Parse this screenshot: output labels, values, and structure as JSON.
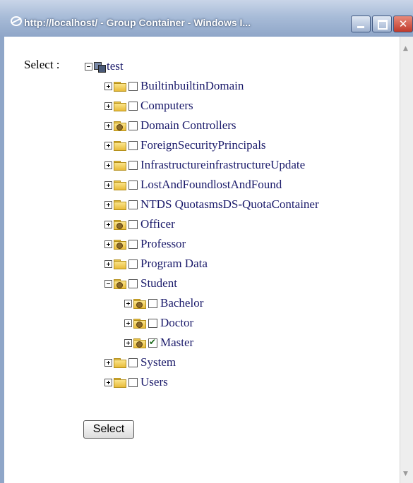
{
  "window": {
    "title": "http://localhost/ - Group Container - Windows I...",
    "close_glyph": "✕"
  },
  "form": {
    "select_label": "Select :",
    "select_button": "Select"
  },
  "tree": {
    "root": "test",
    "nodes": [
      {
        "label": "BuiltinbuiltinDomain",
        "icon": "folder-icon",
        "checked": false
      },
      {
        "label": "Computers",
        "icon": "folder-icon",
        "checked": false
      },
      {
        "label": "Domain Controllers",
        "icon": "org-unit-icon",
        "checked": false
      },
      {
        "label": "ForeignSecurityPrincipals",
        "icon": "folder-icon",
        "checked": false
      },
      {
        "label": "InfrastructureinfrastructureUpdate",
        "icon": "folder-icon",
        "checked": false
      },
      {
        "label": "LostAndFoundlostAndFound",
        "icon": "folder-icon",
        "checked": false
      },
      {
        "label": "NTDS QuotasmsDS-QuotaContainer",
        "icon": "folder-icon",
        "checked": false
      },
      {
        "label": "Officer",
        "icon": "org-unit-icon",
        "checked": false
      },
      {
        "label": "Professor",
        "icon": "org-unit-icon",
        "checked": false
      },
      {
        "label": "Program Data",
        "icon": "folder-icon",
        "checked": false
      },
      {
        "label": "Student",
        "icon": "org-unit-icon",
        "checked": false,
        "expanded": true
      },
      {
        "label": "Bachelor",
        "icon": "org-unit-icon",
        "checked": false
      },
      {
        "label": "Doctor",
        "icon": "org-unit-icon",
        "checked": false
      },
      {
        "label": "Master",
        "icon": "org-unit-icon",
        "checked": true
      },
      {
        "label": "System",
        "icon": "folder-icon",
        "checked": false
      },
      {
        "label": "Users",
        "icon": "folder-icon",
        "checked": false
      }
    ]
  }
}
